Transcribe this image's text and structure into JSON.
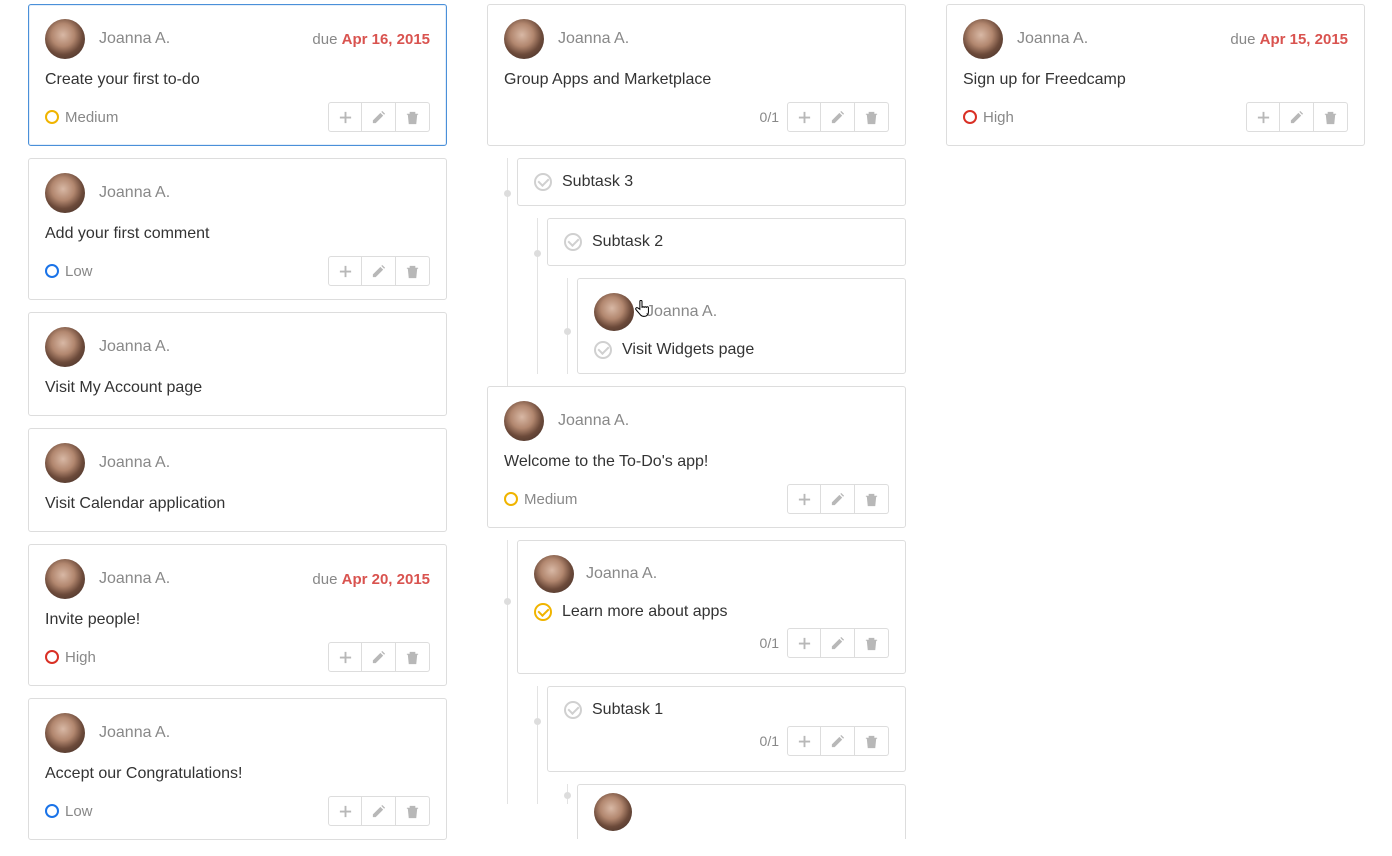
{
  "user": "Joanna A.",
  "due_label": "due ",
  "col1": {
    "items": [
      {
        "title": "Create your first to-do",
        "due": "Apr 16, 2015",
        "priority": "Medium"
      },
      {
        "title": "Add your first comment",
        "priority": "Low"
      },
      {
        "title": "Visit My Account page"
      },
      {
        "title": "Visit Calendar application"
      },
      {
        "title": "Invite people!",
        "due": "Apr 20, 2015",
        "priority": "High"
      },
      {
        "title": "Accept our Congratulations!",
        "priority": "Low"
      }
    ]
  },
  "col2": {
    "card1": {
      "title": "Group Apps and Marketplace",
      "counter": "0/1"
    },
    "sub1": "Subtask 3",
    "sub2": "Subtask 2",
    "sub3": "Visit Widgets page",
    "card2": {
      "title": "Welcome to the To-Do's app!",
      "priority": "Medium"
    },
    "sub4": {
      "title": "Learn more about apps",
      "counter": "0/1"
    },
    "sub5": {
      "title": "Subtask 1",
      "counter": "0/1"
    }
  },
  "col3": {
    "card1": {
      "title": "Sign up for Freedcamp",
      "due": "Apr 15, 2015",
      "priority": "High"
    }
  }
}
